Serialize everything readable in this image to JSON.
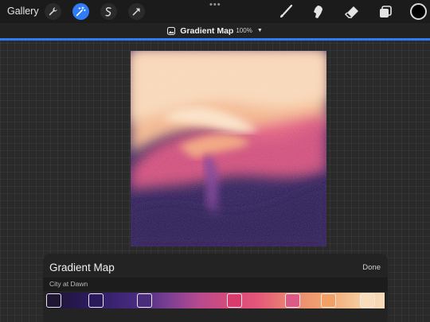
{
  "toolbar": {
    "gallery_label": "Gallery",
    "tools": [
      {
        "name": "wrench-icon",
        "active": false
      },
      {
        "name": "magic-wand-icon",
        "active": true
      },
      {
        "name": "selection-icon",
        "active": false
      },
      {
        "name": "transform-arrow-icon",
        "active": false
      }
    ],
    "right_tools": [
      "brush-icon",
      "smudge-icon",
      "eraser-icon",
      "layers-icon"
    ],
    "current_color": "#000000",
    "accent": "#2f7cf6"
  },
  "title_bar": {
    "name": "Gradient Map",
    "percent": "100%"
  },
  "panel": {
    "title": "Gradient Map",
    "done_label": "Done",
    "preset_name": "City at Dawn",
    "stops": [
      {
        "color": "#1e1633",
        "position": 0.0
      },
      {
        "color": "#2a1a5c",
        "position": 0.13
      },
      {
        "color": "#4a2b7c",
        "position": 0.28
      },
      {
        "color": "#d93c6c",
        "position": 0.56
      },
      {
        "color": "#de5a86",
        "position": 0.74
      },
      {
        "color": "#f2a064",
        "position": 0.85
      },
      {
        "color": "#f9dcbc",
        "position": 0.97
      }
    ]
  }
}
